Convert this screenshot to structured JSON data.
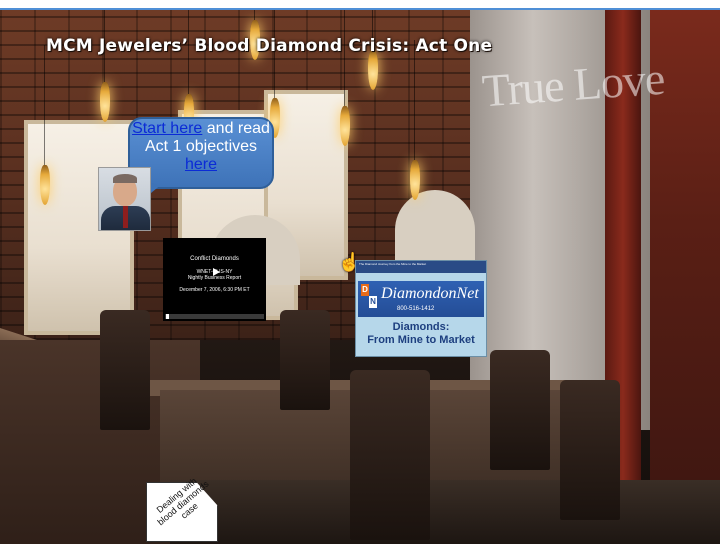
{
  "page": {
    "title": "MCM Jewelers’ Blood Diamond Crisis: Act One",
    "background_sign": "True Love"
  },
  "intro_bubble": {
    "link1_text": "Start here",
    "text_mid": " and read Act 1 objectives ",
    "link2_text": "here"
  },
  "video1": {
    "title": "Conflict Diamonds",
    "line2": "WNET-CLIS-NY",
    "line3": "Nightly Business Report",
    "line4": "December 7, 2006, 6:30 PM ET"
  },
  "video2": {
    "top_strip": "The Diamond Journey from the Mine to the Market",
    "brand": "DiamondonNet",
    "phone": "800-516-1412",
    "caption_line1": "Diamonds:",
    "caption_line2": "From Mine to Market"
  },
  "corner_tag": {
    "text": "Dealing with blood diamonds case"
  },
  "colors": {
    "bubble": "#4a82c8",
    "link_blue": "#0b2bd6"
  }
}
